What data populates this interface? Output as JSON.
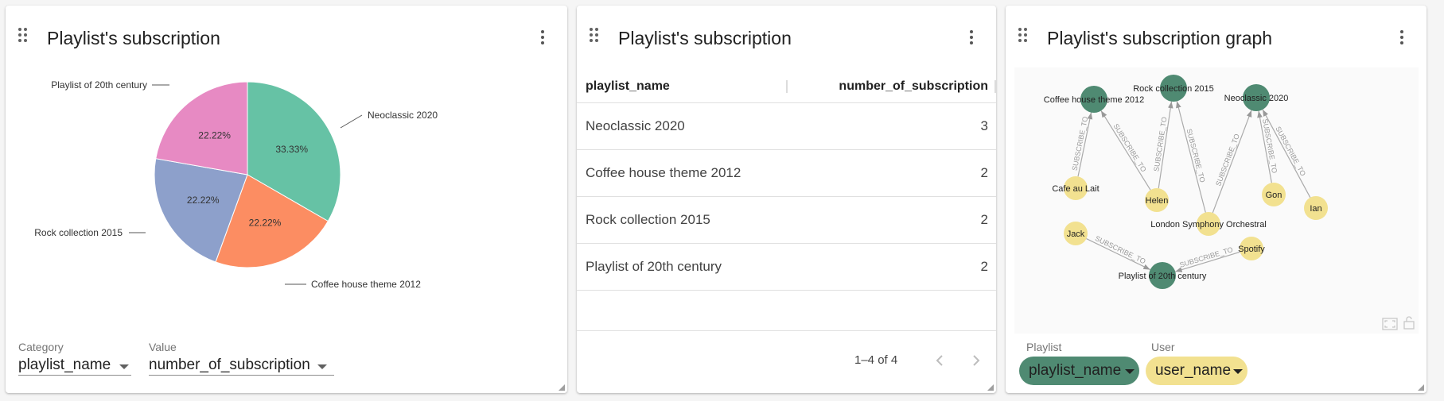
{
  "colors": {
    "pie_green": "#66c2a5",
    "pie_orange": "#fc8d62",
    "pie_blue": "#8da0cb",
    "pie_pink": "#e78ac3",
    "playlist_node": "#4f8a72",
    "user_node": "#f2e190"
  },
  "pie_card": {
    "title": "Playlist's subscription",
    "category_label": "Category",
    "category_value": "playlist_name",
    "value_label": "Value",
    "value_value": "number_of_subscription"
  },
  "chart_data": {
    "type": "pie",
    "labels": [
      "Neoclassic 2020",
      "Coffee house theme 2012",
      "Rock collection 2015",
      "Playlist of 20th century"
    ],
    "values": [
      3,
      2,
      2,
      2
    ],
    "percent_labels": [
      "33.33%",
      "22.22%",
      "22.22%",
      "22.22%"
    ],
    "colors": [
      "#66c2a5",
      "#fc8d62",
      "#8da0cb",
      "#e78ac3"
    ]
  },
  "table_card": {
    "title": "Playlist's subscription",
    "columns": [
      "playlist_name",
      "number_of_subscription"
    ],
    "rows": [
      {
        "playlist_name": "Neoclassic 2020",
        "number_of_subscription": "3"
      },
      {
        "playlist_name": "Coffee house theme 2012",
        "number_of_subscription": "2"
      },
      {
        "playlist_name": "Rock collection 2015",
        "number_of_subscription": "2"
      },
      {
        "playlist_name": "Playlist of 20th century",
        "number_of_subscription": "2"
      }
    ],
    "pagination": "1–4 of 4"
  },
  "graph_card": {
    "title": "Playlist's subscription graph",
    "playlists": [
      "Coffee house theme 2012",
      "Rock collection 2015",
      "Neoclassic 2020",
      "Playlist of 20th century"
    ],
    "users": [
      "Cafe au Lait",
      "Helen",
      "London Symphony Orchestral",
      "Gon",
      "Ian",
      "Jack",
      "Spotify"
    ],
    "relationship": "SUBSCRIBE_TO",
    "edges": [
      [
        "Cafe au Lait",
        "Coffee house theme 2012"
      ],
      [
        "Helen",
        "Coffee house theme 2012"
      ],
      [
        "Helen",
        "Rock collection 2015"
      ],
      [
        "London Symphony Orchestral",
        "Rock collection 2015"
      ],
      [
        "London Symphony Orchestral",
        "Neoclassic 2020"
      ],
      [
        "Gon",
        "Neoclassic 2020"
      ],
      [
        "Ian",
        "Neoclassic 2020"
      ],
      [
        "Jack",
        "Playlist of 20th century"
      ],
      [
        "Spotify",
        "Playlist of 20th century"
      ]
    ],
    "playlist_label": "Playlist",
    "playlist_value": "playlist_name",
    "user_label": "User",
    "user_value": "user_name"
  }
}
